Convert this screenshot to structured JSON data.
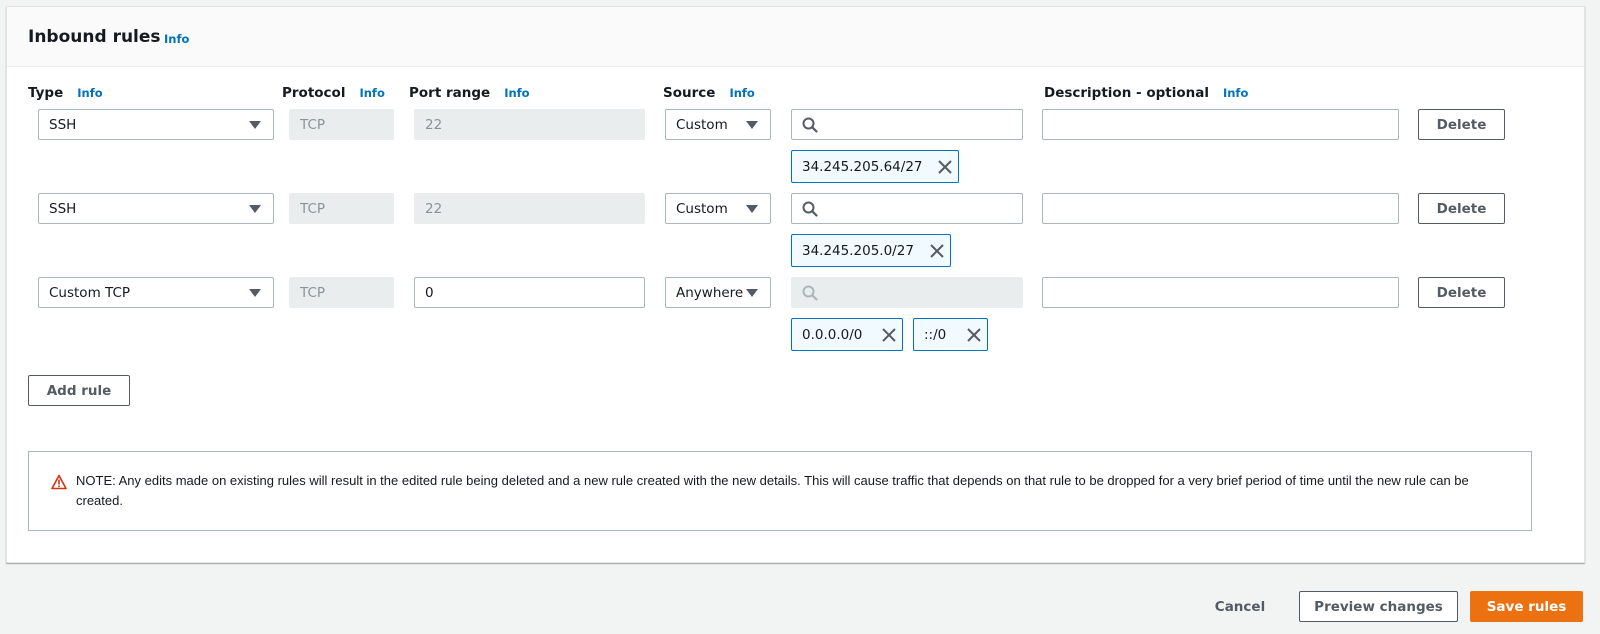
{
  "panel": {
    "title": "Inbound rules",
    "info_label": "Info"
  },
  "columns": {
    "type": "Type",
    "protocol": "Protocol",
    "port_range": "Port range",
    "source": "Source",
    "description": "Description - optional",
    "info_label": "Info"
  },
  "rules": [
    {
      "type": "SSH",
      "protocol": "TCP",
      "port_range": "22",
      "port_editable": false,
      "source_mode": "Custom",
      "search_value": "",
      "search_disabled": false,
      "cidrs": [
        "34.245.205.64/27"
      ],
      "description": "",
      "delete_label": "Delete"
    },
    {
      "type": "SSH",
      "protocol": "TCP",
      "port_range": "22",
      "port_editable": false,
      "source_mode": "Custom",
      "search_value": "",
      "search_disabled": false,
      "cidrs": [
        "34.245.205.0/27"
      ],
      "description": "",
      "delete_label": "Delete"
    },
    {
      "type": "Custom TCP",
      "protocol": "TCP",
      "port_range": "0",
      "port_editable": true,
      "source_mode": "Anywhere",
      "search_value": "",
      "search_disabled": true,
      "cidrs": [
        "0.0.0.0/0",
        "::/0"
      ],
      "description": "",
      "delete_label": "Delete"
    }
  ],
  "add_rule_label": "Add rule",
  "note": {
    "icon": "warning-triangle-icon",
    "text": "NOTE: Any edits made on existing rules will result in the edited rule being deleted and a new rule created with the new details. This will cause traffic that depends on that rule to be dropped for a very brief period of time until the new rule can be created."
  },
  "footer": {
    "cancel_label": "Cancel",
    "preview_label": "Preview changes",
    "save_label": "Save rules"
  },
  "colors": {
    "info_link": "#0073bb",
    "primary_button": "#ec7211",
    "token_border": "#0073bb",
    "token_bg": "#f1faff",
    "warning": "#d13212"
  }
}
